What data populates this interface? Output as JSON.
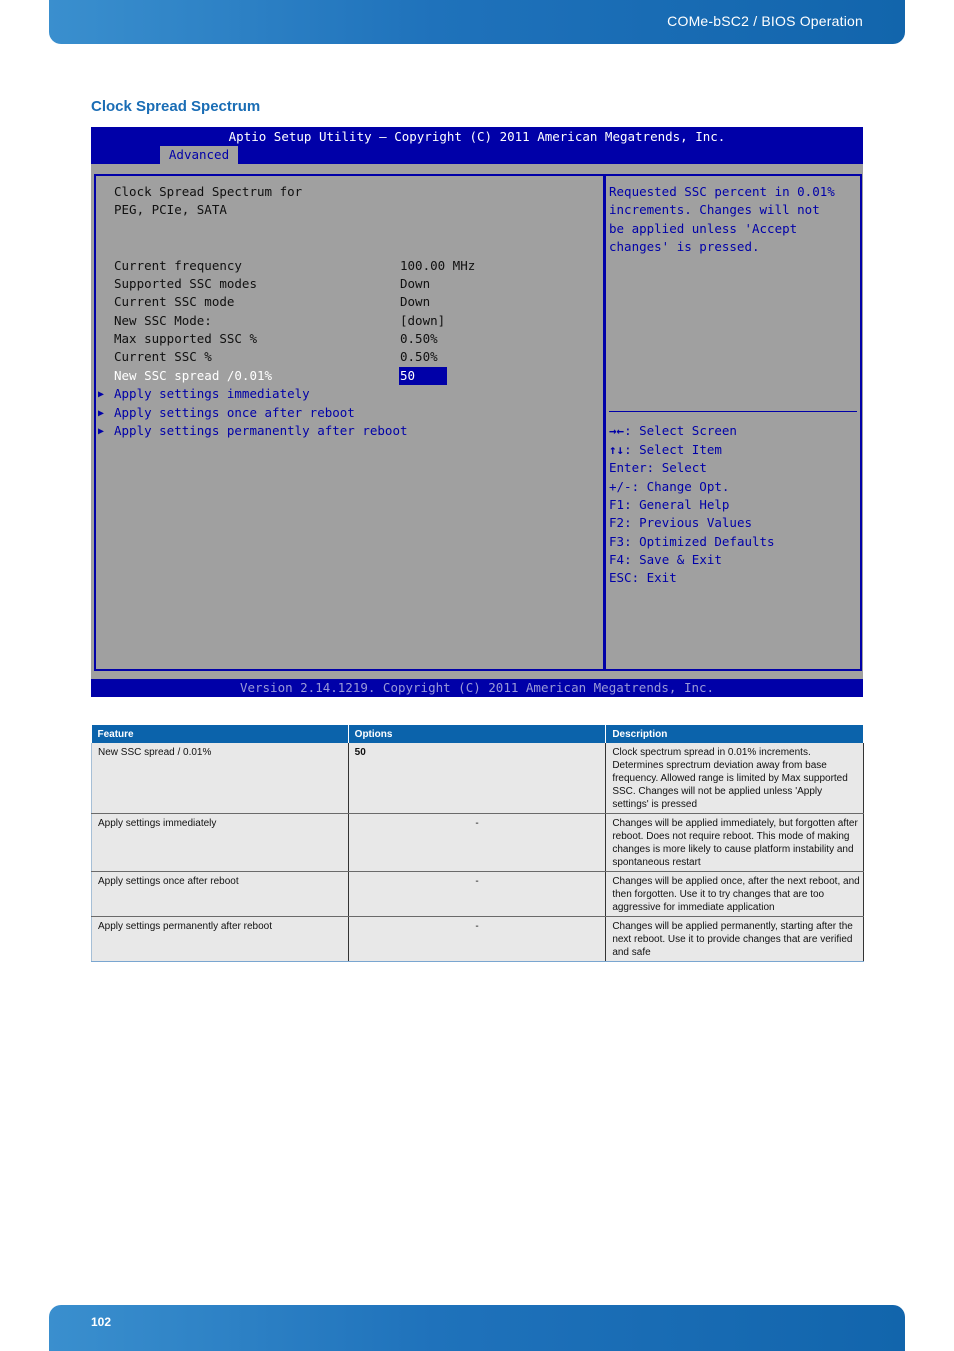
{
  "header": {
    "title": "COMe-bSC2 / BIOS Operation"
  },
  "section_title": "Clock Spread Spectrum",
  "bios": {
    "title": "Aptio Setup Utility – Copyright (C) 2011 American Megatrends, Inc.",
    "active_tab": "Advanced",
    "heading_lines": [
      "Clock Spread Spectrum for",
      "PEG, PCIe, SATA"
    ],
    "fields": [
      {
        "label": "Current frequency",
        "value": "100.00 MHz"
      },
      {
        "label": "Supported SSC modes",
        "value": "Down"
      },
      {
        "label": "Current SSC mode",
        "value": "Down"
      },
      {
        "label": "New SSC Mode:",
        "value": "[down]"
      },
      {
        "label": "Max supported SSC %",
        "value": "0.50%"
      },
      {
        "label": "Current SSC %",
        "value": "0.50%"
      },
      {
        "label": "New SSC spread /0.01%",
        "value": "50",
        "selected": true
      }
    ],
    "submenus": [
      "Apply settings immediately",
      "Apply settings once after reboot",
      "Apply settings permanently after reboot"
    ],
    "help_text": [
      "Requested SSC percent in 0.01%",
      "increments. Changes will not",
      "be applied unless 'Accept",
      "changes' is pressed."
    ],
    "keys": [
      {
        "key": "→←",
        "action": ": Select Screen"
      },
      {
        "key": "↑↓",
        "action": ": Select Item"
      },
      {
        "key": "Enter",
        "action": ": Select"
      },
      {
        "key": "+/-",
        "action": ": Change Opt."
      },
      {
        "key": "F1",
        "action": ": General Help"
      },
      {
        "key": "F2",
        "action": ": Previous Values"
      },
      {
        "key": "F3",
        "action": ": Optimized Defaults"
      },
      {
        "key": "F4",
        "action": ": Save & Exit"
      },
      {
        "key": "ESC",
        "action": ": Exit"
      }
    ],
    "footer": "Version 2.14.1219. Copyright (C) 2011 American Megatrends, Inc."
  },
  "table": {
    "headers": [
      "Feature",
      "Options",
      "Description"
    ],
    "rows": [
      {
        "feature": "New SSC spread / 0.01%",
        "options": "50",
        "description": "Clock spectrum spread in 0.01% increments. Determines sprectrum deviation away from base frequency. Allowed range is limited by Max supported SSC. Changes will not be applied unless 'Apply settings' is pressed"
      },
      {
        "feature": "Apply settings immediately",
        "options": "-",
        "description": "Changes will be applied immediately, but forgotten after reboot. Does not require reboot. This mode of making changes is more likely to cause platform instability and spontaneous restart"
      },
      {
        "feature": "Apply settings once after reboot",
        "options": "-",
        "description": "Changes will be applied once, after the next reboot, and then forgotten. Use it to try changes that are too aggressive for immediate application"
      },
      {
        "feature": "Apply settings permanently after reboot",
        "options": "-",
        "description": "Changes will be applied permanently, starting after the next reboot. Use it to provide changes that are verified and safe"
      }
    ]
  },
  "footer": {
    "page_number": "102"
  }
}
